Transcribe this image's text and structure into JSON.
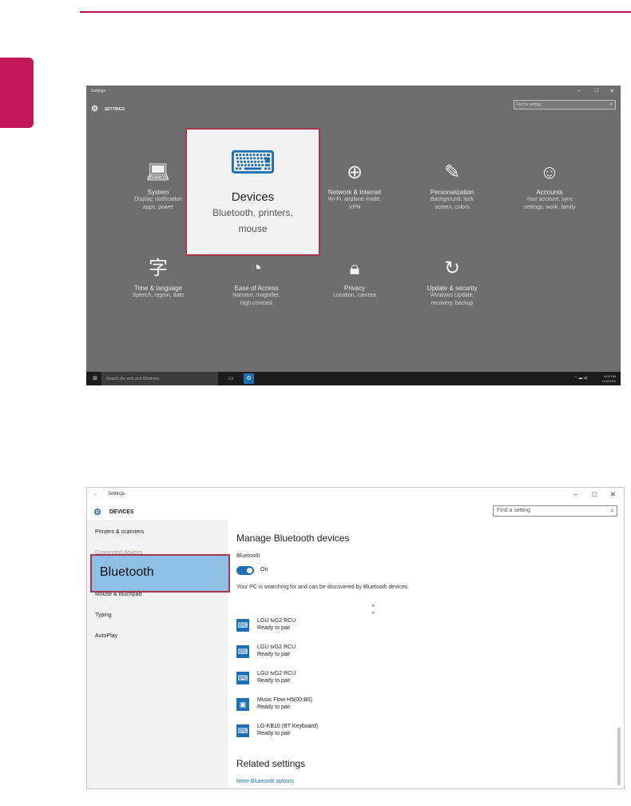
{
  "shot1": {
    "window_title": "Settings",
    "window_controls": [
      "–",
      "□",
      "✕"
    ],
    "header_title": "SETTINGS",
    "search_placeholder": "Find a setting",
    "tiles": [
      {
        "title": "System",
        "desc": [
          "Display, notification",
          "apps, power"
        ],
        "icon": "laptop-icon"
      },
      {
        "title": "Devices",
        "desc": [
          "Bluetooth, printers,",
          "mouse"
        ],
        "icon": "devices-icon"
      },
      {
        "title": "Network & Internet",
        "desc": [
          "Wi-Fi, airplane mode,",
          "VPN"
        ],
        "icon": "globe-icon"
      },
      {
        "title": "Personalization",
        "desc": [
          "Background, lock",
          "screen, colors"
        ],
        "icon": "paint-icon"
      },
      {
        "title": "Accounts",
        "desc": [
          "Your account, sync",
          "settings, work, family"
        ],
        "icon": "person-icon"
      },
      {
        "title": "Time & language",
        "desc": [
          "Speech, region, date"
        ],
        "icon": "language-icon"
      },
      {
        "title": "Ease of Access",
        "desc": [
          "Narrator, magnifier,",
          "high contrast"
        ],
        "icon": "ease-icon"
      },
      {
        "title": "Privacy",
        "desc": [
          "Location, camera"
        ],
        "icon": "lock-icon"
      },
      {
        "title": "Update & security",
        "desc": [
          "Windows Update,",
          "recovery, backup"
        ],
        "icon": "refresh-icon"
      }
    ],
    "taskbar": {
      "search_text": "Search the web and Windows",
      "time": "8:09 AM",
      "date": "7/15/2015"
    }
  },
  "shot2": {
    "window_title": "Settings",
    "window_controls": [
      "–",
      "□",
      "✕"
    ],
    "header_title": "DEVICES",
    "search_placeholder": "Find a setting",
    "nav": [
      "Printers & scanners",
      "Connected devices",
      "Bluetooth",
      "Mouse & touchpad",
      "Typing",
      "AutoPlay"
    ],
    "main": {
      "heading": "Manage Bluetooth devices",
      "bluetooth_label": "Bluetooth",
      "toggle_state": "On",
      "info_text": "Your PC is searching for and can be discovered by Bluetooth devices.",
      "devices": [
        {
          "name": "LGU tvG2 RCU",
          "status": "Ready to pair"
        },
        {
          "name": "LGU tvG2 RCU",
          "status": "Ready to pair"
        },
        {
          "name": "LGU tvG2 RCU",
          "status": "Ready to pair"
        },
        {
          "name": "Music Flow H5(00:B0)",
          "status": "Ready to pair"
        },
        {
          "name": "LG-KB10 (BT Keyboard)",
          "status": "Ready to pair"
        }
      ],
      "related_heading": "Related settings",
      "related_link": "More Bluetooth options"
    }
  },
  "colors": {
    "accent": "#c2185b",
    "windows_blue": "#1f6fb5",
    "highlight_border": "#a8344f"
  }
}
